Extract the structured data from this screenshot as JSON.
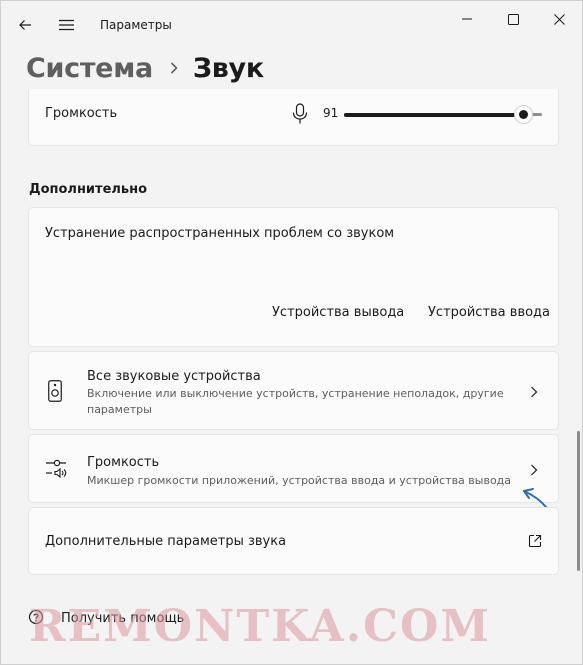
{
  "window": {
    "title": "Параметры"
  },
  "breadcrumb": {
    "parent": "Система",
    "current": "Звук"
  },
  "volume_row": {
    "label": "Громкость",
    "value": "91",
    "level_percent": 91
  },
  "advanced": {
    "section_title": "Дополнительно",
    "troubleshoot": {
      "title": "Устранение распространенных проблем со звуком",
      "output_button": "Устройства вывода",
      "input_button": "Устройства ввода"
    },
    "all_devices": {
      "title": "Все звуковые устройства",
      "subtitle": "Включение или выключение устройств, устранение неполадок, другие параметры"
    },
    "volume_mixer": {
      "title": "Громкость",
      "subtitle": "Микшер громкости приложений, устройства ввода и устройства вывода"
    },
    "more_settings": {
      "title": "Дополнительные параметры звука"
    }
  },
  "help": {
    "label": "Получить помощь"
  },
  "watermark": {
    "text": "REMONTKA.COM"
  },
  "colors": {
    "accent_arrow": "#2a6fb6",
    "watermark": "#dc969b"
  }
}
